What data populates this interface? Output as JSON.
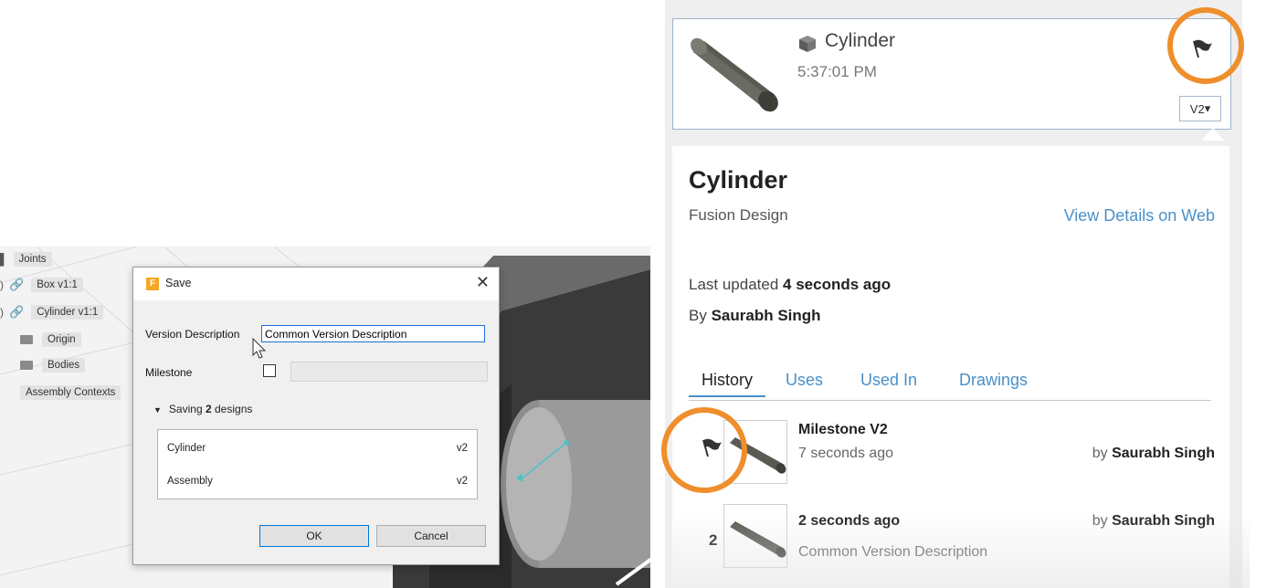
{
  "browser_tree": {
    "joints": "Joints",
    "box": "Box v1:1",
    "cylinder": "Cylinder v1:1",
    "origin": "Origin",
    "bodies": "Bodies",
    "assembly_contexts": "Assembly Contexts"
  },
  "save_dialog": {
    "title": "Save",
    "logo": "F",
    "close": "✕",
    "version_description_label": "Version Description",
    "version_description_value": "Common Version Description",
    "milestone_label": "Milestone",
    "milestone_checked": false,
    "saving_prefix": "Saving",
    "saving_count": "2",
    "saving_suffix": "designs",
    "designs": [
      {
        "name": "Cylinder",
        "version": "v2"
      },
      {
        "name": "Assembly",
        "version": "v2"
      }
    ],
    "ok_label": "OK",
    "cancel_label": "Cancel"
  },
  "data_panel": {
    "card": {
      "name": "Cylinder",
      "time": "5:37:01 PM",
      "version": "V2",
      "version_caret": "▾"
    },
    "details": {
      "title": "Cylinder",
      "type": "Fusion Design",
      "view_web": "View Details on Web",
      "last_updated_prefix": "Last updated",
      "last_updated_value": "4 seconds ago",
      "by_prefix": "By",
      "by_value": "Saurabh Singh"
    },
    "tabs": [
      "History",
      "Uses",
      "Used In",
      "Drawings"
    ],
    "history": [
      {
        "title": "Milestone V2",
        "subtitle": "7 seconds ago",
        "by_prefix": "by",
        "by": "Saurabh Singh"
      },
      {
        "number": "2",
        "title": "2 seconds ago",
        "subtitle": "Common Version Description",
        "by_prefix": "by",
        "by": "Saurabh Singh"
      }
    ]
  },
  "colors": {
    "highlight_ring": "#ef8e2c",
    "link_blue": "#4a90c9",
    "dialog_focus": "#1e6fd9"
  },
  "icons": [
    "chain-link-icon",
    "folder-icon",
    "box-icon",
    "flag-icon",
    "close-icon",
    "caret-down-icon",
    "mouse-cursor-icon"
  ]
}
